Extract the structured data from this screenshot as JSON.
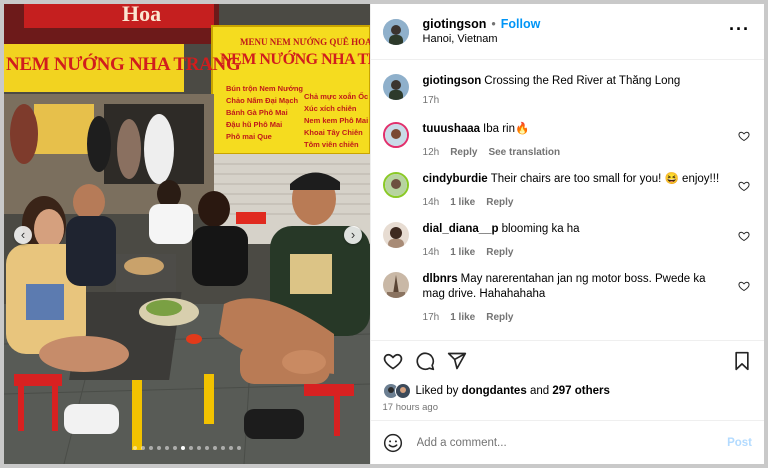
{
  "post": {
    "username": "giotingson",
    "separator": "•",
    "follow_label": "Follow",
    "location": "Hanoi, Vietnam",
    "more_icon": "more-horizontal-icon"
  },
  "signs": {
    "top_left": "Hoa",
    "left_banner": "NEM NƯỚNG NHA TRANG",
    "menu_title": "MENU NEM NƯỚNG QUÊ HOA",
    "menu_big": "NEM NƯỚNG NHA TRANG",
    "menu_left": [
      "Bún trộn Nem Nướng",
      "Chảo Nấm Đại Mạch",
      "Bánh Gà Phô Mai",
      "Đậu hũ Phô Mai",
      "Phô mai Que"
    ],
    "menu_right": [
      "Chả mực xoắn Ốc",
      "Xúc xích chiên",
      "Nem kem Phô Mai",
      "Khoai Tây Chiên",
      "Tôm viên chiên"
    ]
  },
  "media": {
    "prev_icon": "chevron-left-icon",
    "next_icon": "chevron-right-icon",
    "prev_glyph": "‹",
    "next_glyph": "›"
  },
  "caption": {
    "username": "giotingson",
    "text": "Crossing the Red River at Thăng Long",
    "time": "17h"
  },
  "comments": [
    {
      "username": "tuuushaaa",
      "text": "Iba rin🔥",
      "time": "12h",
      "likes": "",
      "reply": "Reply",
      "translate": "See translation"
    },
    {
      "username": "cindyburdie",
      "text": "Their chairs are too small for you! 😆 enjoy!!!",
      "time": "14h",
      "likes": "1 like",
      "reply": "Reply",
      "translate": ""
    },
    {
      "username": "dial_diana__p",
      "text": "blooming ka ha",
      "time": "14h",
      "likes": "1 like",
      "reply": "Reply",
      "translate": ""
    },
    {
      "username": "dlbnrs",
      "text": "May narerentahan jan ng motor boss. Pwede ka mag drive. Hahahahaha",
      "time": "17h",
      "likes": "1 like",
      "reply": "Reply",
      "translate": ""
    }
  ],
  "likes": {
    "prefix": "Liked by",
    "user": "dongdantes",
    "and": "and",
    "others": "297 others",
    "time_ago": "17 hours ago"
  },
  "add_comment": {
    "placeholder": "Add a comment...",
    "post_label": "Post"
  },
  "colors": {
    "follow": "#0095f6",
    "post_disabled": "#b3dbff",
    "muted": "#737373"
  }
}
